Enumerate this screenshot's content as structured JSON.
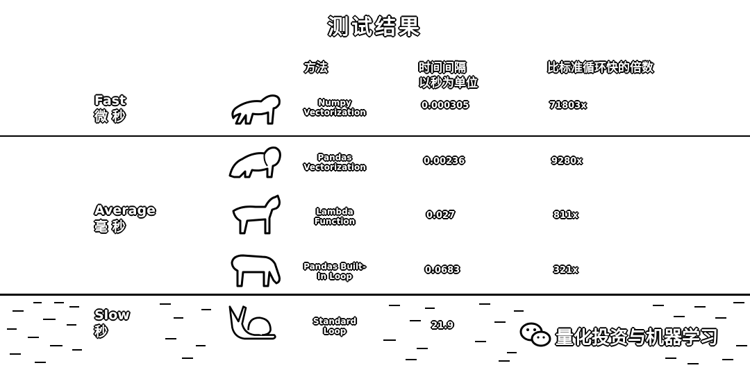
{
  "title": "测试结果",
  "headers": {
    "method": "方法",
    "time_line1": "时间间隔",
    "time_line2": "以秒为单位",
    "ratio": "比标准循环快的倍数"
  },
  "groups": {
    "fast": {
      "label": "Fast",
      "unit": "微 秒"
    },
    "average": {
      "label": "Average",
      "unit": "毫 秒"
    },
    "slow": {
      "label": "Slow",
      "unit": "秒"
    }
  },
  "rows": [
    {
      "animal": "cheetah-icon",
      "method_line1": "Numpy",
      "method_line2": "Vectorization",
      "time": "0.000305",
      "ratio": "71803x"
    },
    {
      "animal": "lion-icon",
      "method_line1": "Pandas",
      "method_line2": "Vectorization",
      "time": "0.00236",
      "ratio": "9280x"
    },
    {
      "animal": "horse-icon",
      "method_line1": "Lambda",
      "method_line2": "Function",
      "time": "0.027",
      "ratio": "811x"
    },
    {
      "animal": "donkey-icon",
      "method_line1": "Pandas Built-",
      "method_line2": "In Loop",
      "time": "0.0683",
      "ratio": "321x"
    },
    {
      "animal": "snail-icon",
      "method_line1": "Standard",
      "method_line2": "Loop",
      "time": "21.9",
      "ratio": ""
    }
  ],
  "watermark": "量化投资与机器学习"
}
